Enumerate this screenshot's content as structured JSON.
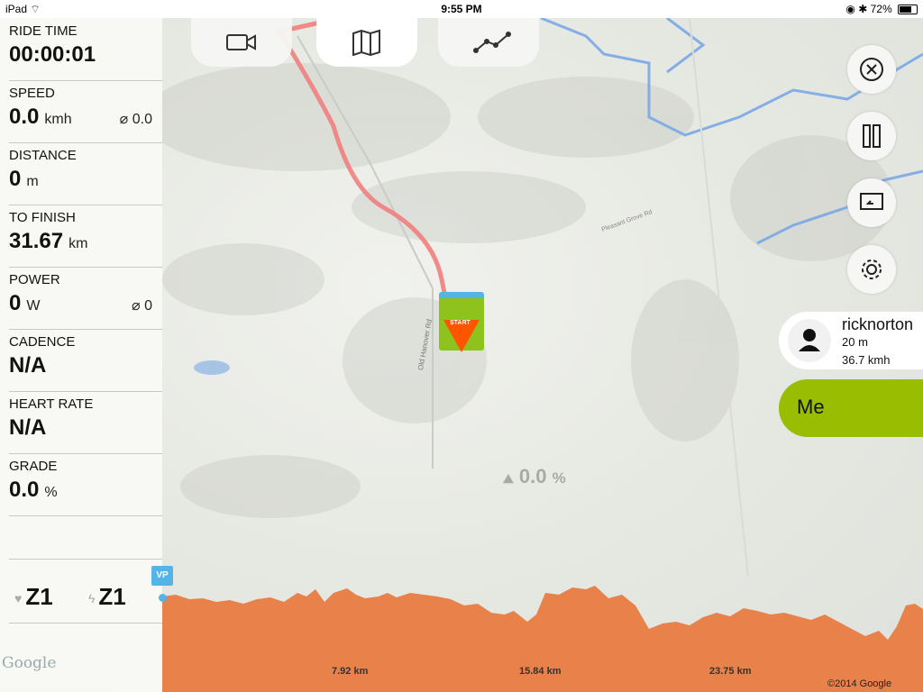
{
  "status_bar": {
    "device": "iPad",
    "time": "9:55 PM",
    "battery": "72%",
    "battery_level": 0.72
  },
  "tabs": [
    {
      "name": "video",
      "icon": "video-camera-icon"
    },
    {
      "name": "map",
      "icon": "map-icon",
      "active": true
    },
    {
      "name": "chart",
      "icon": "line-chart-icon"
    }
  ],
  "metrics": {
    "ride_time": {
      "label": "RIDE TIME",
      "value": "00:00:01"
    },
    "speed": {
      "label": "SPEED",
      "value": "0.0",
      "unit": "kmh",
      "avg": "⌀ 0.0"
    },
    "distance": {
      "label": "DISTANCE",
      "value": "0",
      "unit": "m"
    },
    "to_finish": {
      "label": "TO FINISH",
      "value": "31.67",
      "unit": "km"
    },
    "power": {
      "label": "POWER",
      "value": "0",
      "unit": "W",
      "avg": "⌀ 0"
    },
    "cadence": {
      "label": "CADENCE",
      "value": "N/A"
    },
    "heart_rate": {
      "label": "HEART RATE",
      "value": "N/A"
    },
    "grade": {
      "label": "GRADE",
      "value": "0.0",
      "unit": "%"
    }
  },
  "zones": {
    "heart_zone": "Z1",
    "power_zone": "Z1"
  },
  "google_logo": "Google",
  "map": {
    "road_label_1": "Old Hanover Rd",
    "road_label_2": "Pleasant Grove Rd",
    "start_label": "START",
    "current_grade": "0.0",
    "grade_unit": "%"
  },
  "right_buttons": [
    {
      "name": "close",
      "icon": "close-icon"
    },
    {
      "name": "pause",
      "icon": "pause-icon"
    },
    {
      "name": "airplay",
      "icon": "airplay-icon"
    },
    {
      "name": "settings",
      "icon": "gear-icon"
    }
  ],
  "riders": [
    {
      "name": "ricknorton",
      "distance": "20 m",
      "speed": "36.7 kmh"
    }
  ],
  "me_label": "Me",
  "elevation": {
    "marker": "VP",
    "km_labels": [
      "7.92 km",
      "15.84 km",
      "23.75 km"
    ],
    "copyright": "©2014 Google",
    "color": "#e8814a"
  },
  "colors": {
    "accent": "#99bd00",
    "route": "#f08080",
    "water": "#7aa8e6",
    "marker": "#55b4e6"
  }
}
